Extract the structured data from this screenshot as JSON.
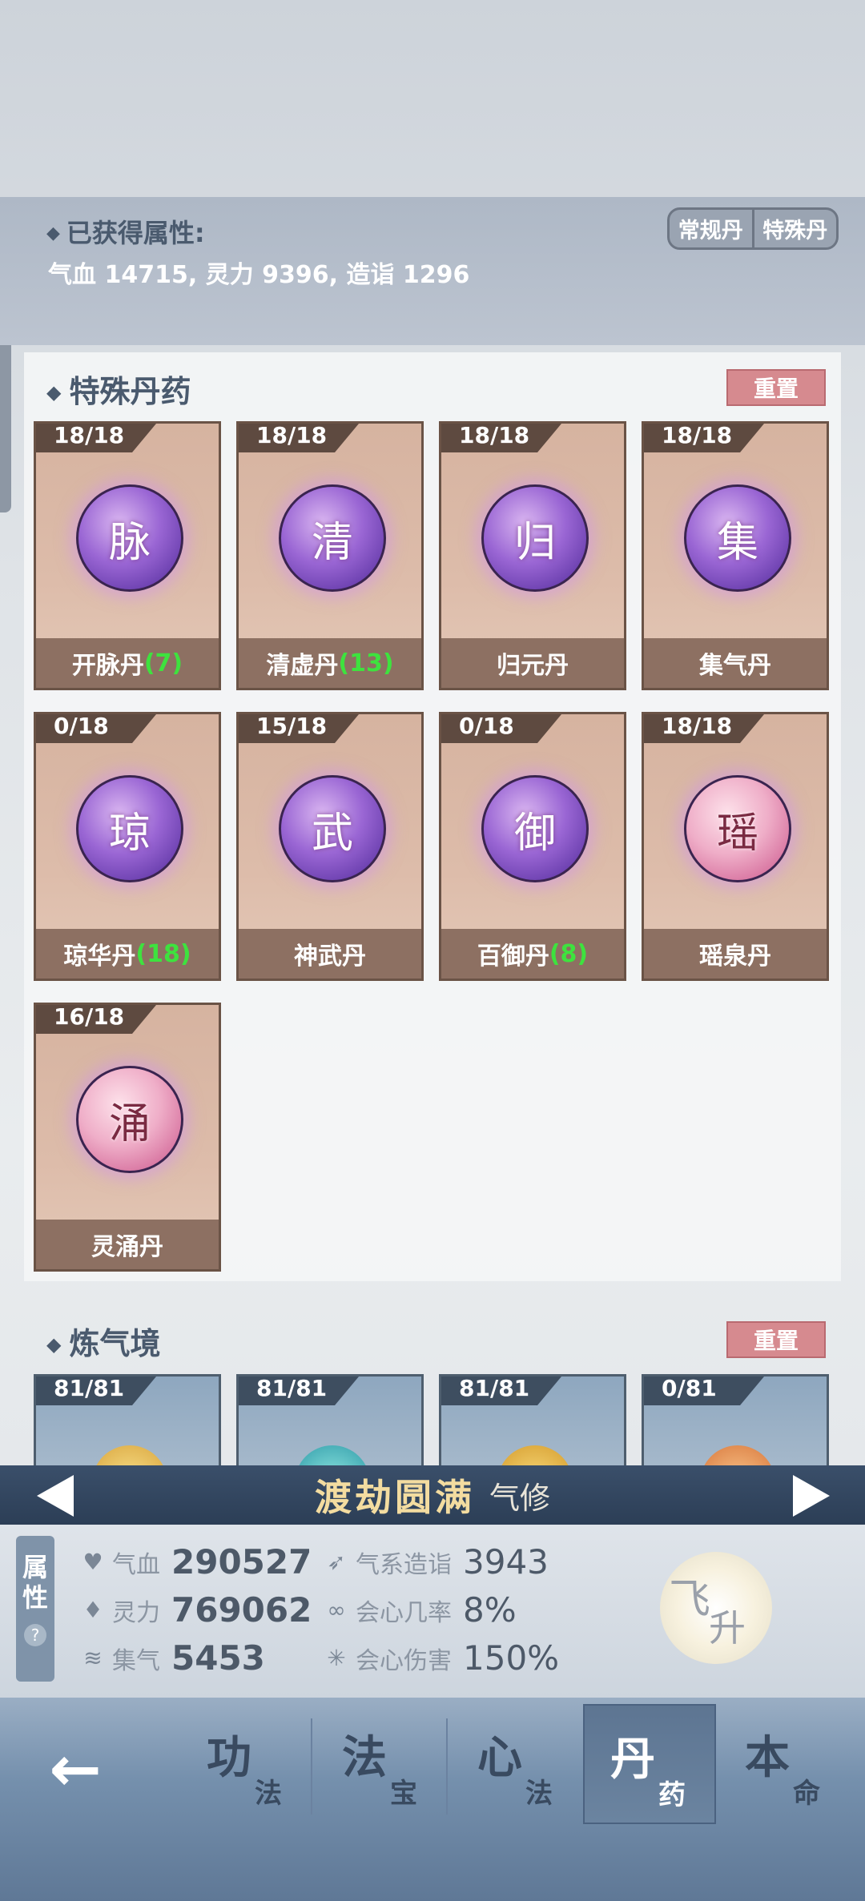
{
  "obtained": {
    "title": "已获得属性:",
    "values": "气血 14715, 灵力 9396, 造诣 1296"
  },
  "type_toggle": {
    "regular": "常规丹",
    "special": "特殊丹"
  },
  "special_section": {
    "title": "特殊丹药",
    "reset_label": "重置",
    "pills": [
      {
        "count": "18/18",
        "glyph": "脉",
        "name": "开脉丹",
        "extra": "(7)"
      },
      {
        "count": "18/18",
        "glyph": "清",
        "name": "清虚丹",
        "extra": "(13)"
      },
      {
        "count": "18/18",
        "glyph": "归",
        "name": "归元丹",
        "extra": ""
      },
      {
        "count": "18/18",
        "glyph": "集",
        "name": "集气丹",
        "extra": ""
      },
      {
        "count": "0/18",
        "glyph": "琼",
        "name": "琼华丹",
        "extra": "(18)"
      },
      {
        "count": "15/18",
        "glyph": "武",
        "name": "神武丹",
        "extra": ""
      },
      {
        "count": "0/18",
        "glyph": "御",
        "name": "百御丹",
        "extra": "(8)"
      },
      {
        "count": "18/18",
        "glyph": "瑶",
        "name": "瑶泉丹",
        "extra": ""
      },
      {
        "count": "16/18",
        "glyph": "涌",
        "name": "灵涌丹",
        "extra": ""
      }
    ]
  },
  "qi_section": {
    "title": "炼气境",
    "reset_label": "重置",
    "pills": [
      {
        "count": "81/81"
      },
      {
        "count": "81/81"
      },
      {
        "count": "81/81"
      },
      {
        "count": "0/81"
      }
    ]
  },
  "realm": {
    "name": "渡劫圆满",
    "type": "气修"
  },
  "attr_tab": {
    "line1": "属",
    "line2": "性",
    "help": "?"
  },
  "stats": {
    "hp_label": "气血",
    "hp_value": "290527",
    "sp_label": "灵力",
    "sp_value": "769062",
    "gather_label": "集气",
    "gather_value": "5453",
    "mastery_label": "气系造诣",
    "mastery_value": "3943",
    "crit_rate_label": "会心几率",
    "crit_rate_value": "8%",
    "crit_dmg_label": "会心伤害",
    "crit_dmg_value": "150%"
  },
  "ascend": {
    "char1": "飞",
    "char2": "升"
  },
  "nav": {
    "back": "←",
    "tabs": [
      {
        "big": "功",
        "small": "法"
      },
      {
        "big": "法",
        "small": "宝"
      },
      {
        "big": "心",
        "small": "法"
      },
      {
        "big": "丹",
        "small": "药"
      },
      {
        "big": "本",
        "small": "命"
      }
    ]
  },
  "colors": {
    "accent_green": "#3ee23e",
    "reset_red": "#d68a8f",
    "realm_gold": "#f3dca0"
  }
}
